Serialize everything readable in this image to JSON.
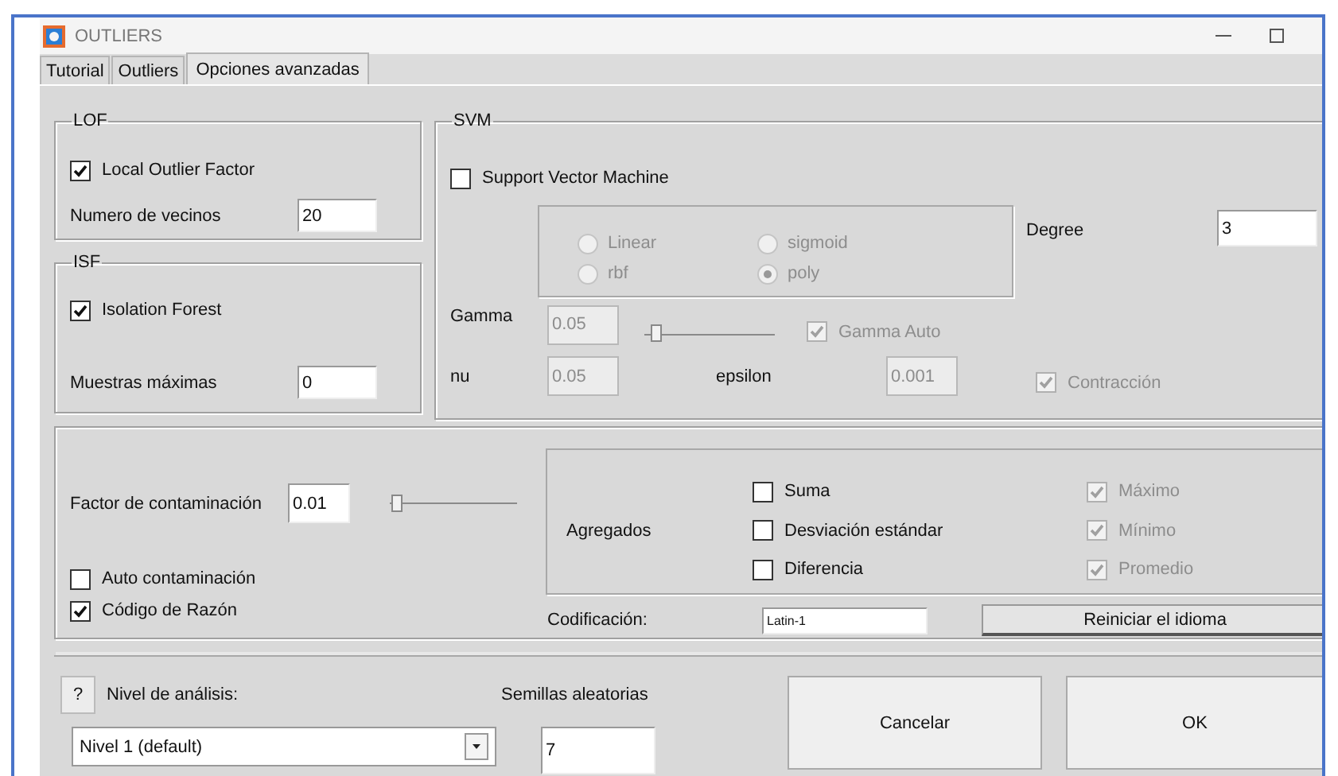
{
  "window": {
    "title": "OUTLIERS"
  },
  "tabs": [
    {
      "label": "Tutorial",
      "selected": false
    },
    {
      "label": "Outliers",
      "selected": false
    },
    {
      "label": "Opciones avanzadas",
      "selected": true
    }
  ],
  "lof": {
    "title": "LOF",
    "enable": {
      "label": "Local Outlier Factor",
      "checked": true,
      "disabled": false
    },
    "neighbors": {
      "label": "Numero de vecinos",
      "value": "20",
      "disabled": false
    }
  },
  "isf": {
    "title": "ISF",
    "enable": {
      "label": "Isolation Forest",
      "checked": true,
      "disabled": false
    },
    "max_samples": {
      "label": "Muestras máximas",
      "value": "0",
      "disabled": false
    }
  },
  "svm": {
    "title": "SVM",
    "enable": {
      "label": "Support Vector Machine",
      "checked": false,
      "disabled": false
    },
    "kernels": [
      {
        "label": "Linear",
        "selected": false,
        "disabled": true
      },
      {
        "label": "sigmoid",
        "selected": false,
        "disabled": true
      },
      {
        "label": "rbf",
        "selected": false,
        "disabled": true
      },
      {
        "label": "poly",
        "selected": true,
        "disabled": true
      }
    ],
    "degree": {
      "label": "Degree",
      "value": "3",
      "disabled": false
    },
    "gamma": {
      "label": "Gamma",
      "value": "0.05",
      "disabled": true
    },
    "gamma_slider": {
      "level": 0.05
    },
    "gamma_auto": {
      "label": "Gamma Auto",
      "checked": true,
      "disabled": true
    },
    "nu": {
      "label": "nu",
      "value": "0.05",
      "disabled": true
    },
    "epsilon": {
      "label": "epsilon",
      "value": "0.001",
      "disabled": true
    },
    "contraction": {
      "label": "Contracción",
      "checked": true,
      "disabled": true
    }
  },
  "contamination": {
    "label": "Factor de contaminación",
    "value": "0.01",
    "disabled": false
  },
  "contamination_slider": {
    "level": 0.02
  },
  "auto_contamination": {
    "label": "Auto contaminación",
    "checked": false,
    "disabled": false
  },
  "reason_code": {
    "label": "Código de Razón",
    "checked": true,
    "disabled": false
  },
  "aggregates": {
    "label": "Agregados",
    "options": [
      {
        "label": "Suma",
        "checked": false,
        "disabled": false
      },
      {
        "label": "Máximo",
        "checked": true,
        "disabled": true
      },
      {
        "label": "Desviación estándar",
        "checked": false,
        "disabled": false
      },
      {
        "label": "Mínimo",
        "checked": true,
        "disabled": true
      },
      {
        "label": "Diferencia",
        "checked": false,
        "disabled": false
      },
      {
        "label": "Promedio",
        "checked": true,
        "disabled": true
      }
    ]
  },
  "encoding": {
    "label": "Codificación:",
    "value": "Latin-1",
    "disabled": false
  },
  "reset_language_button": "Reiniciar el idioma",
  "footer": {
    "help_button": "?",
    "analysis_level": {
      "label": "Nivel de análisis:",
      "value": "Nivel 1 (default)"
    },
    "random_seeds": {
      "label": "Semillas aleatorias",
      "value": "7",
      "disabled": false
    },
    "buttons": [
      "Cancelar",
      "OK"
    ]
  }
}
